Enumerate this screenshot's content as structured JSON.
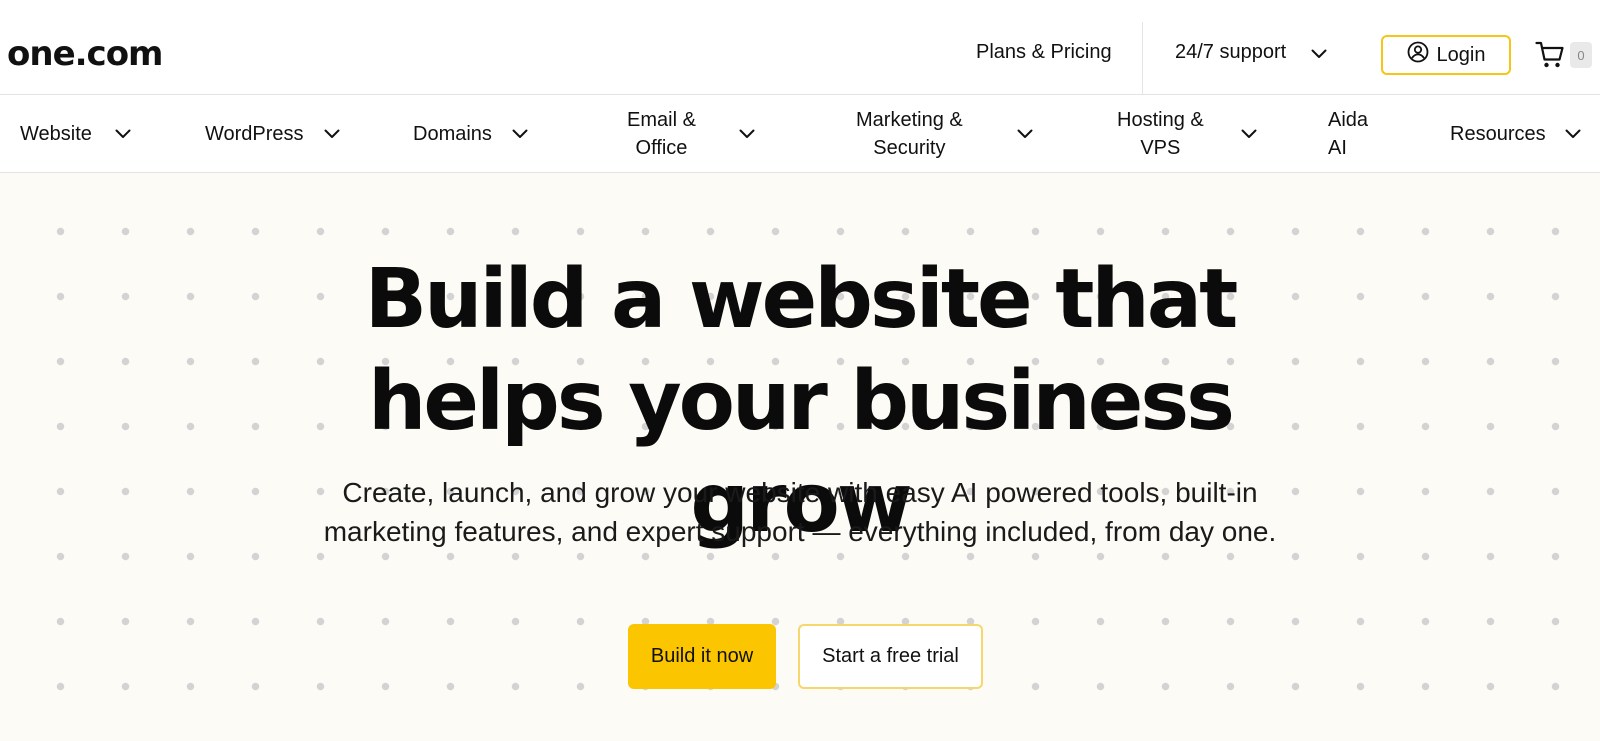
{
  "header": {
    "logo": "one.com",
    "plans_label": "Plans & Pricing",
    "support_label": "24/7 support",
    "login_label": "Login",
    "cart_count": "0"
  },
  "nav": {
    "items": [
      {
        "label": "Website"
      },
      {
        "label": "WordPress"
      },
      {
        "label": "Domains"
      },
      {
        "label": "Email &\nOffice"
      },
      {
        "label": "Marketing &\nSecurity"
      },
      {
        "label": "Hosting &\nVPS"
      },
      {
        "label": "Aida\nAI"
      },
      {
        "label": "Resources"
      }
    ]
  },
  "hero": {
    "title_line1": "Build a website that",
    "title_line2": "helps your business grow",
    "subtitle": "Create, launch, and grow your website with easy AI powered tools, built-in marketing features, and expert support — everything included, from day one.",
    "primary_cta": "Build it now",
    "secondary_cta": "Start a free trial"
  },
  "colors": {
    "accent": "#fbc500",
    "hero_background": "#fcfbf6",
    "text": "#111111"
  },
  "icons": {
    "login": "user-circle-icon",
    "cart": "shopping-cart-icon",
    "dropdown": "chevron-down-icon"
  }
}
